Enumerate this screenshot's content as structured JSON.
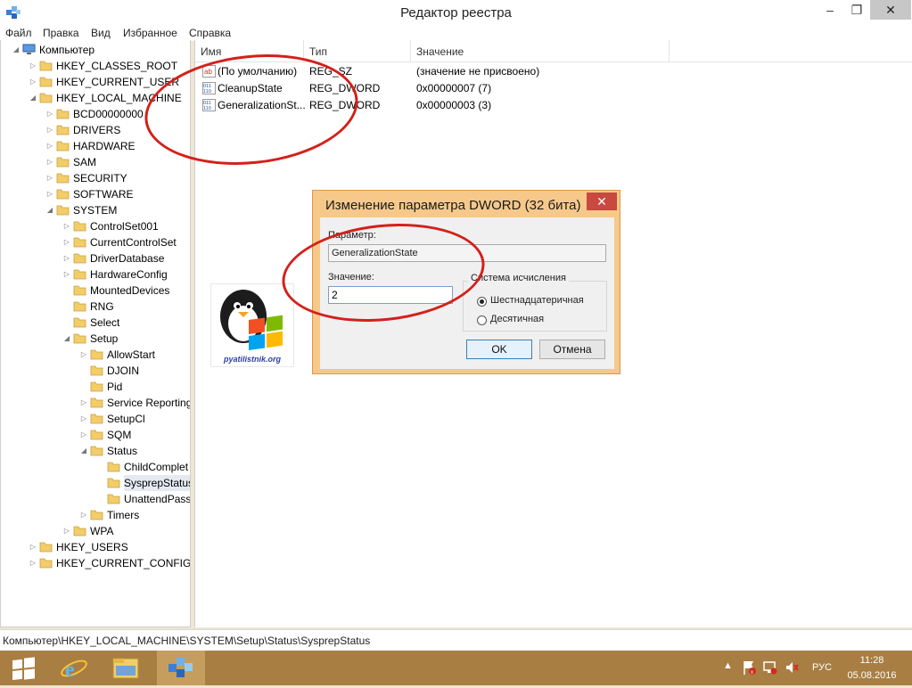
{
  "window": {
    "title": "Редактор реестра",
    "min_glyph": "–",
    "max_glyph": "❐",
    "close_glyph": "✕"
  },
  "menu": [
    "Файл",
    "Правка",
    "Вид",
    "Избранное",
    "Справка"
  ],
  "tree": [
    {
      "label": "Компьютер",
      "arrow": "◢"
    },
    {
      "label": "HKEY_CLASSES_ROOT",
      "arrow": "▷"
    },
    {
      "label": "HKEY_CURRENT_USER",
      "arrow": "▷"
    },
    {
      "label": "HKEY_LOCAL_MACHINE",
      "arrow": "◢"
    },
    {
      "label": "BCD00000000",
      "arrow": "▷"
    },
    {
      "label": "DRIVERS",
      "arrow": "▷"
    },
    {
      "label": "HARDWARE",
      "arrow": "▷"
    },
    {
      "label": "SAM",
      "arrow": "▷"
    },
    {
      "label": "SECURITY",
      "arrow": "▷"
    },
    {
      "label": "SOFTWARE",
      "arrow": "▷"
    },
    {
      "label": "SYSTEM",
      "arrow": "◢"
    },
    {
      "label": "ControlSet001",
      "arrow": "▷"
    },
    {
      "label": "CurrentControlSet",
      "arrow": "▷"
    },
    {
      "label": "DriverDatabase",
      "arrow": "▷"
    },
    {
      "label": "HardwareConfig",
      "arrow": "▷"
    },
    {
      "label": "MountedDevices",
      "arrow": ""
    },
    {
      "label": "RNG",
      "arrow": ""
    },
    {
      "label": "Select",
      "arrow": ""
    },
    {
      "label": "Setup",
      "arrow": "◢"
    },
    {
      "label": "AllowStart",
      "arrow": "▷"
    },
    {
      "label": "DJOIN",
      "arrow": ""
    },
    {
      "label": "Pid",
      "arrow": ""
    },
    {
      "label": "Service Reporting",
      "arrow": "▷"
    },
    {
      "label": "SetupCl",
      "arrow": "▷"
    },
    {
      "label": "SQM",
      "arrow": "▷"
    },
    {
      "label": "Status",
      "arrow": "◢"
    },
    {
      "label": "ChildComplet",
      "arrow": ""
    },
    {
      "label": "SysprepStatus",
      "arrow": ""
    },
    {
      "label": "UnattendPass",
      "arrow": ""
    },
    {
      "label": "Timers",
      "arrow": "▷"
    },
    {
      "label": "WPA",
      "arrow": "▷"
    },
    {
      "label": "HKEY_USERS",
      "arrow": "▷"
    },
    {
      "label": "HKEY_CURRENT_CONFIG",
      "arrow": "▷"
    }
  ],
  "columns": {
    "name": "Имя",
    "type": "Тип",
    "value": "Значение"
  },
  "values": [
    {
      "icon": "ab",
      "name": "(По умолчанию)",
      "type": "REG_SZ",
      "data": "(значение не присвоено)"
    },
    {
      "icon": "011",
      "name": "CleanupState",
      "type": "REG_DWORD",
      "data": "0x00000007 (7)"
    },
    {
      "icon": "011",
      "name": "GeneralizationSt...",
      "type": "REG_DWORD",
      "data": "0x00000003 (3)"
    }
  ],
  "logo": {
    "text": "pyatilistnik.org"
  },
  "dialog": {
    "title": "Изменение параметра DWORD (32 бита)",
    "close_glyph": "✕",
    "param_label": "Параметр:",
    "param_value": "GeneralizationState",
    "value_label": "Значение:",
    "value_input": "2",
    "base_label": "Система исчисления",
    "radio_hex": "Шестнадцатеричная",
    "radio_dec": "Десятичная",
    "selected_base": "hex",
    "ok": "OK",
    "cancel": "Отмена"
  },
  "status_path": "Компьютер\\HKEY_LOCAL_MACHINE\\SYSTEM\\Setup\\Status\\SysprepStatus",
  "taskbar": {
    "apps": [
      "start-icon",
      "internet-explorer-icon",
      "file-explorer-icon",
      "regedit-icon"
    ],
    "tray_lang": "РУС",
    "clock_time": "11:28",
    "clock_date": "05.08.2016"
  },
  "colors": {
    "annotation": "#d4201a",
    "dialog_frame": "#f6c98a",
    "taskbar": "#a87e43"
  }
}
